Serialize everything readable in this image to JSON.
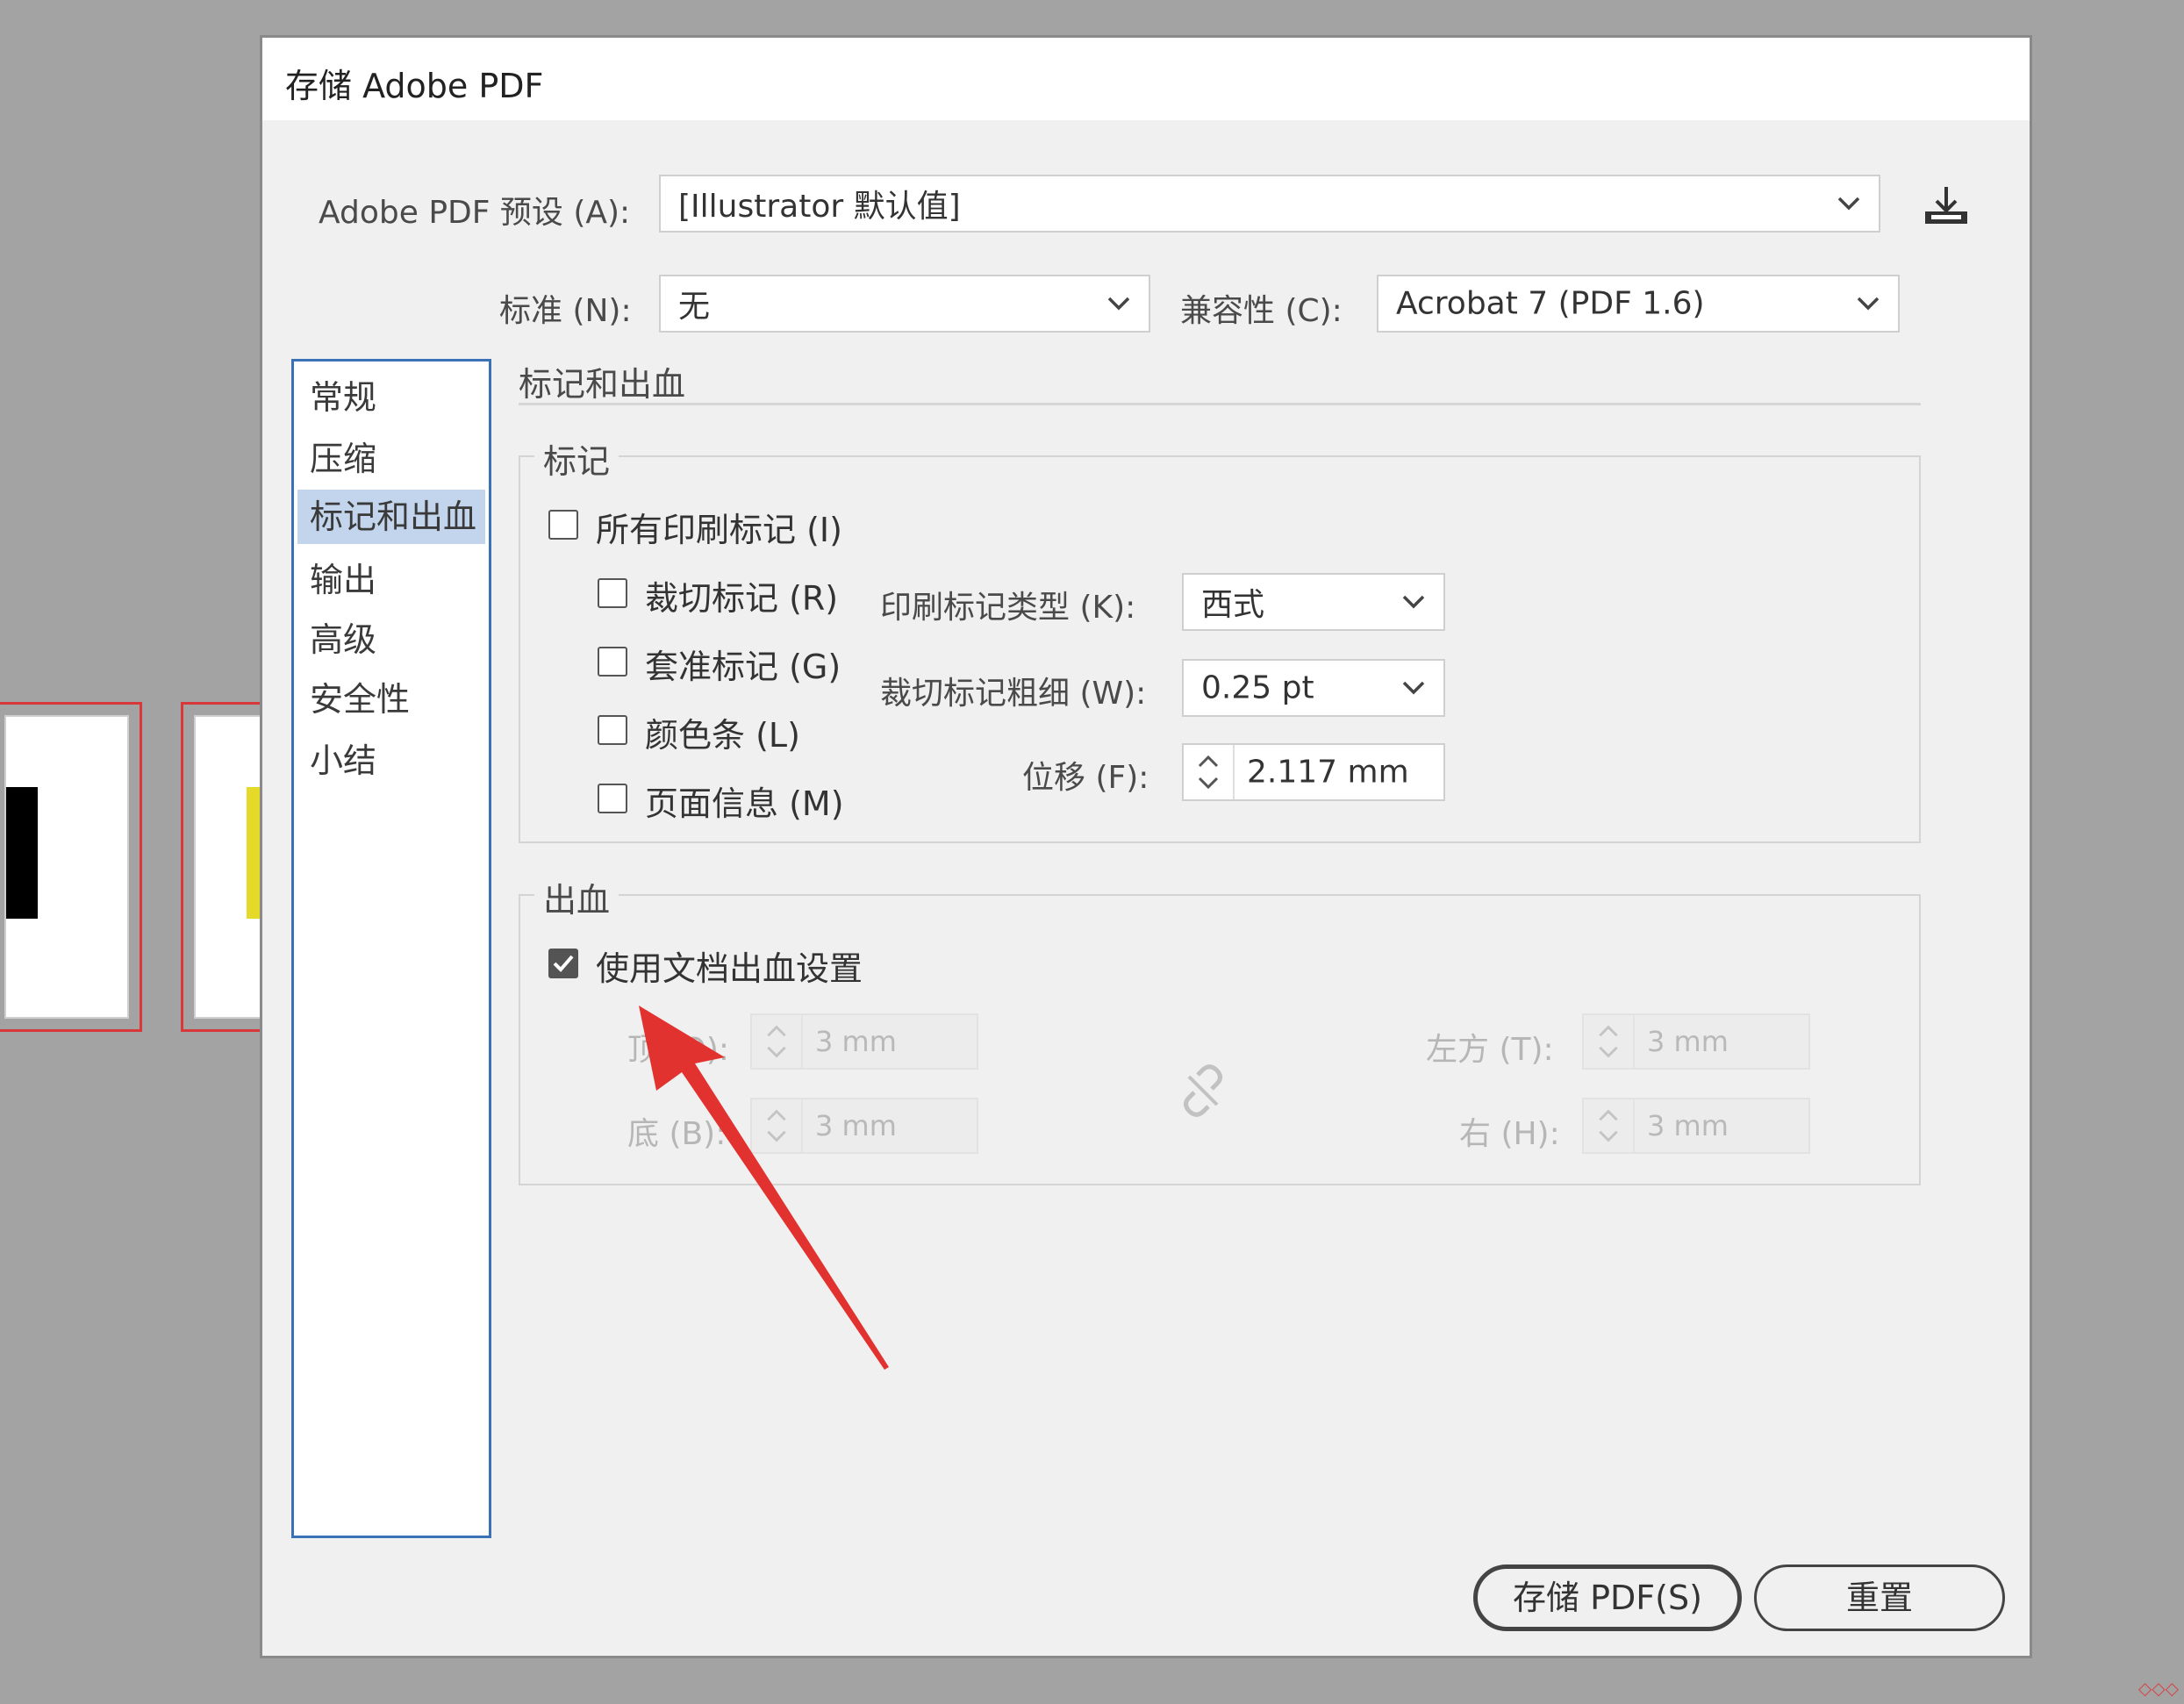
{
  "dialog": {
    "title": "存储 Adobe PDF",
    "preset": {
      "label": "Adobe PDF 预设 (A):",
      "value": "[Illustrator 默认值]"
    },
    "standard": {
      "label": "标准 (N):",
      "value": "无"
    },
    "compat": {
      "label": "兼容性 (C):",
      "value": "Acrobat 7 (PDF 1.6)"
    },
    "nav": [
      {
        "label": "常规"
      },
      {
        "label": "压缩"
      },
      {
        "label": "标记和出血",
        "active": true
      },
      {
        "label": "输出"
      },
      {
        "label": "高级"
      },
      {
        "label": "安全性"
      },
      {
        "label": "小结"
      }
    ],
    "section_title": "标记和出血",
    "marks": {
      "legend": "标记",
      "all_marks": "所有印刷标记 (I)",
      "trim": "裁切标记 (R)",
      "reg": "套准标记 (G)",
      "color_bar": "颜色条 (L)",
      "page_info": "页面信息 (M)",
      "type_label": "印刷标记类型 (K):",
      "type_value": "西式",
      "weight_label": "裁切标记粗细 (W):",
      "weight_value": "0.25 pt",
      "offset_label": "位移 (F):",
      "offset_value": "2.117 mm"
    },
    "bleed": {
      "legend": "出血",
      "use_doc": "使用文档出血设置",
      "top_label": "顶 (O):",
      "top_value": "3 mm",
      "bottom_label": "底 (B):",
      "bottom_value": "3 mm",
      "left_label": "左方 (T):",
      "left_value": "3 mm",
      "right_label": "右 (H):",
      "right_value": "3 mm"
    },
    "save_button": "存储 PDF(S)",
    "reset_button": "重置"
  },
  "colors": {
    "accent_border": "#3b72b5",
    "nav_selected": "#c3d5ec",
    "annotation_arrow": "#e2322f"
  }
}
